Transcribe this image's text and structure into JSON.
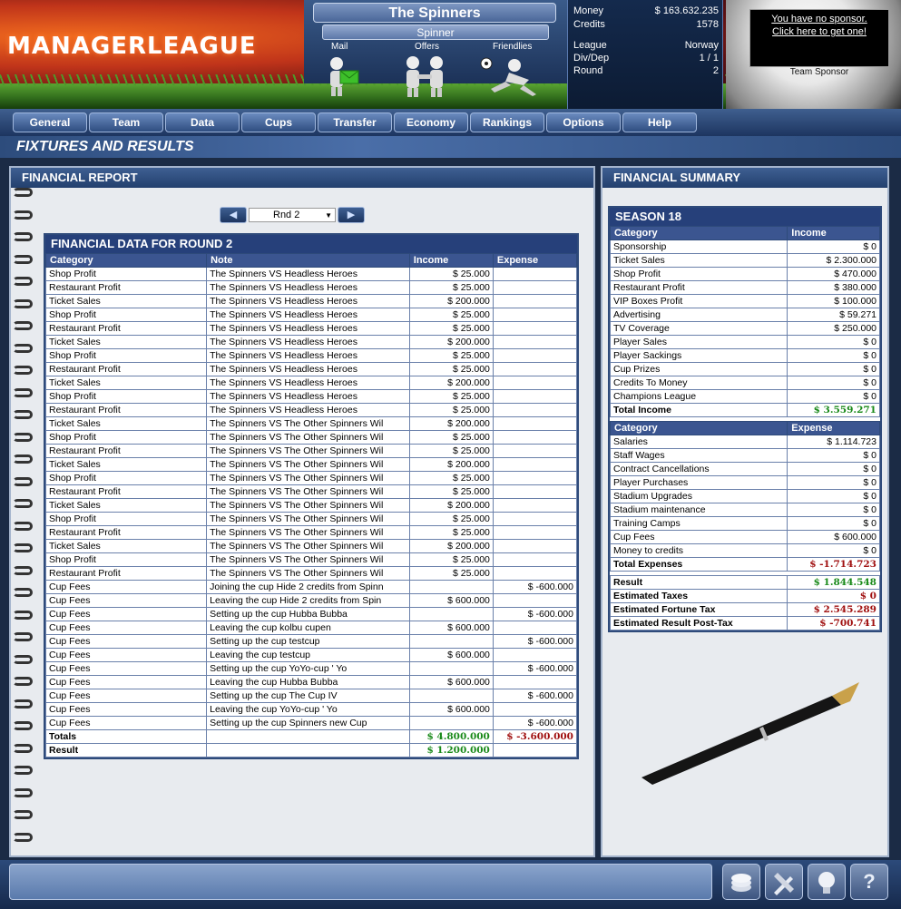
{
  "header": {
    "logo": "MANAGERLEAGUE",
    "team_name": "The Spinners",
    "manager_name": "Spinner",
    "links": {
      "mail": "Mail",
      "offers": "Offers",
      "friendlies": "Friendlies"
    },
    "stats": {
      "money_label": "Money",
      "money": "$ 163.632.235",
      "credits_label": "Credits",
      "credits": "1578",
      "league_label": "League",
      "league": "Norway",
      "divdep_label": "Div/Dep",
      "divdep": "1 / 1",
      "round_label": "Round",
      "round": "2"
    },
    "sponsor": {
      "line1": "You have no sponsor.",
      "line2": "Click here to get one!",
      "label": "Team Sponsor"
    }
  },
  "nav": [
    "General",
    "Team",
    "Data",
    "Cups",
    "Transfer",
    "Economy",
    "Rankings",
    "Options",
    "Help"
  ],
  "page_title": "FIXTURES AND RESULTS",
  "left_panel": {
    "title": "FINANCIAL REPORT",
    "round_selected": "Rnd 2",
    "table_title": "FINANCIAL DATA FOR ROUND 2",
    "columns": [
      "Category",
      "Note",
      "Income",
      "Expense"
    ],
    "rows": [
      [
        "Shop Profit",
        "The Spinners VS Headless Heroes",
        "$ 25.000",
        ""
      ],
      [
        "Restaurant Profit",
        "The Spinners VS Headless Heroes",
        "$ 25.000",
        ""
      ],
      [
        "Ticket Sales",
        "The Spinners VS Headless Heroes",
        "$ 200.000",
        ""
      ],
      [
        "Shop Profit",
        "The Spinners VS Headless Heroes",
        "$ 25.000",
        ""
      ],
      [
        "Restaurant Profit",
        "The Spinners VS Headless Heroes",
        "$ 25.000",
        ""
      ],
      [
        "Ticket Sales",
        "The Spinners VS Headless Heroes",
        "$ 200.000",
        ""
      ],
      [
        "Shop Profit",
        "The Spinners VS Headless Heroes",
        "$ 25.000",
        ""
      ],
      [
        "Restaurant Profit",
        "The Spinners VS Headless Heroes",
        "$ 25.000",
        ""
      ],
      [
        "Ticket Sales",
        "The Spinners VS Headless Heroes",
        "$ 200.000",
        ""
      ],
      [
        "Shop Profit",
        "The Spinners VS Headless Heroes",
        "$ 25.000",
        ""
      ],
      [
        "Restaurant Profit",
        "The Spinners VS Headless Heroes",
        "$ 25.000",
        ""
      ],
      [
        "Ticket Sales",
        "The Spinners VS The Other Spinners Wil",
        "$ 200.000",
        ""
      ],
      [
        "Shop Profit",
        "The Spinners VS The Other Spinners Wil",
        "$ 25.000",
        ""
      ],
      [
        "Restaurant Profit",
        "The Spinners VS The Other Spinners Wil",
        "$ 25.000",
        ""
      ],
      [
        "Ticket Sales",
        "The Spinners VS The Other Spinners Wil",
        "$ 200.000",
        ""
      ],
      [
        "Shop Profit",
        "The Spinners VS The Other Spinners Wil",
        "$ 25.000",
        ""
      ],
      [
        "Restaurant Profit",
        "The Spinners VS The Other Spinners Wil",
        "$ 25.000",
        ""
      ],
      [
        "Ticket Sales",
        "The Spinners VS The Other Spinners Wil",
        "$ 200.000",
        ""
      ],
      [
        "Shop Profit",
        "The Spinners VS The Other Spinners Wil",
        "$ 25.000",
        ""
      ],
      [
        "Restaurant Profit",
        "The Spinners VS The Other Spinners Wil",
        "$ 25.000",
        ""
      ],
      [
        "Ticket Sales",
        "The Spinners VS The Other Spinners Wil",
        "$ 200.000",
        ""
      ],
      [
        "Shop Profit",
        "The Spinners VS The Other Spinners Wil",
        "$ 25.000",
        ""
      ],
      [
        "Restaurant Profit",
        "The Spinners VS The Other Spinners Wil",
        "$ 25.000",
        ""
      ],
      [
        "Cup Fees",
        "Joining the cup Hide 2 credits from Spinn",
        "",
        "$ -600.000"
      ],
      [
        "Cup Fees",
        "Leaving the cup Hide 2 credits from Spin",
        "$ 600.000",
        ""
      ],
      [
        "Cup Fees",
        "Setting up the cup Hubba Bubba",
        "",
        "$ -600.000"
      ],
      [
        "Cup Fees",
        "Leaving the cup kolbu cupen",
        "$ 600.000",
        ""
      ],
      [
        "Cup Fees",
        "Setting up the cup testcup",
        "",
        "$ -600.000"
      ],
      [
        "Cup Fees",
        "Leaving the cup testcup",
        "$ 600.000",
        ""
      ],
      [
        "Cup Fees",
        "Setting up the cup YoYo-cup ' Yo",
        "",
        "$ -600.000"
      ],
      [
        "Cup Fees",
        "Leaving the cup Hubba Bubba",
        "$ 600.000",
        ""
      ],
      [
        "Cup Fees",
        "Setting up the cup The Cup IV",
        "",
        "$ -600.000"
      ],
      [
        "Cup Fees",
        "Leaving the cup YoYo-cup ' Yo",
        "$ 600.000",
        ""
      ],
      [
        "Cup Fees",
        "Setting up the cup Spinners new Cup",
        "",
        "$ -600.000"
      ]
    ],
    "totals_label": "Totals",
    "totals_income": "$ 4.800.000",
    "totals_expense": "$ -3.600.000",
    "result_label": "Result",
    "result_value": "$ 1.200.000"
  },
  "right_panel": {
    "title": "FINANCIAL SUMMARY",
    "season": "SEASON 18",
    "income_header": [
      "Category",
      "Income"
    ],
    "income_rows": [
      [
        "Sponsorship",
        "$ 0"
      ],
      [
        "Ticket Sales",
        "$ 2.300.000"
      ],
      [
        "Shop Profit",
        "$ 470.000"
      ],
      [
        "Restaurant Profit",
        "$ 380.000"
      ],
      [
        "VIP Boxes Profit",
        "$ 100.000"
      ],
      [
        "Advertising",
        "$ 59.271"
      ],
      [
        "TV Coverage",
        "$ 250.000"
      ],
      [
        "Player Sales",
        "$ 0"
      ],
      [
        "Player Sackings",
        "$ 0"
      ],
      [
        "Cup Prizes",
        "$ 0"
      ],
      [
        "Credits To Money",
        "$ 0"
      ],
      [
        "Champions League",
        "$ 0"
      ]
    ],
    "total_income_label": "Total Income",
    "total_income": "$ 3.559.271",
    "expense_header": [
      "Category",
      "Expense"
    ],
    "expense_rows": [
      [
        "Salaries",
        "$ 1.114.723"
      ],
      [
        "Staff Wages",
        "$ 0"
      ],
      [
        "Contract Cancellations",
        "$ 0"
      ],
      [
        "Player Purchases",
        "$ 0"
      ],
      [
        "Stadium Upgrades",
        "$ 0"
      ],
      [
        "Stadium maintenance",
        "$ 0"
      ],
      [
        "Training Camps",
        "$ 0"
      ],
      [
        "Cup Fees",
        "$ 600.000"
      ],
      [
        "Money to credits",
        "$ 0"
      ]
    ],
    "total_expenses_label": "Total Expenses",
    "total_expenses": "$ -1.714.723",
    "summary": [
      {
        "label": "Result",
        "value": "$ 1.844.548",
        "tone": "pos"
      },
      {
        "label": "Estimated Taxes",
        "value": "$ 0",
        "tone": "neg"
      },
      {
        "label": "Estimated Fortune Tax",
        "value": "$ 2.545.289",
        "tone": "neg"
      },
      {
        "label": "Estimated Result Post-Tax",
        "value": "$ -700.741",
        "tone": "neg"
      }
    ]
  },
  "footer": {
    "buttons": [
      "coins-icon",
      "tools-icon",
      "lightbulb-icon",
      "help-icon"
    ],
    "help_glyph": "?"
  }
}
